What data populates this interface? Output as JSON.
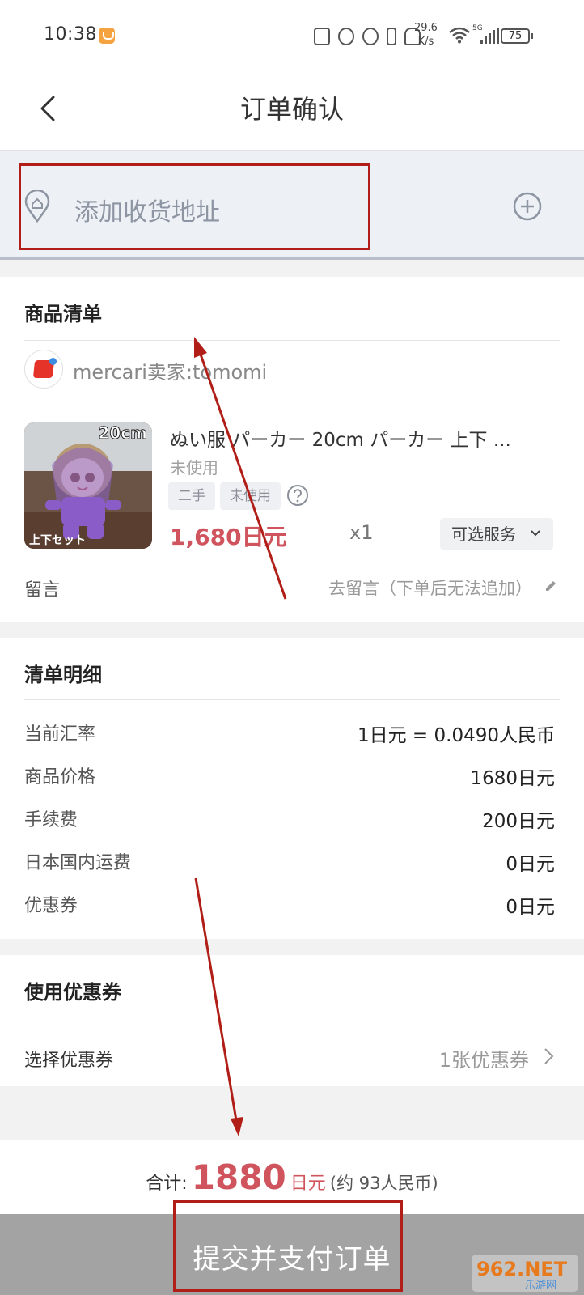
{
  "status_bar": {
    "time": "10:38",
    "net_speed_value": "29.6",
    "net_speed_unit": "K/s",
    "network_type": "5G",
    "battery": "75"
  },
  "navbar": {
    "title": "订单确认"
  },
  "address": {
    "placeholder": "添加收货地址"
  },
  "items_section": {
    "title": "商品清单",
    "seller": "mercari卖家:tomomi",
    "product": {
      "name": "ぬい服 パーカー 20cm パーカー 上下 ...",
      "condition": "未使用",
      "tags": [
        "二手",
        "未使用"
      ],
      "price": "1,680日元",
      "quantity": "x1",
      "service_button": "可选服务",
      "thumbnail_badge": "20cm",
      "thumbnail_caption": "上下セット"
    },
    "message": {
      "label": "留言",
      "value": "去留言（下单后无法追加）"
    }
  },
  "details_section": {
    "title": "清单明细",
    "rows": [
      {
        "label": "当前汇率",
        "value": "1日元 = 0.0490人民币"
      },
      {
        "label": "商品价格",
        "value": "1680日元"
      },
      {
        "label": "手续费",
        "value": "200日元"
      },
      {
        "label": "日本国内运费",
        "value": "0日元"
      },
      {
        "label": "优惠券",
        "value": "0日元"
      }
    ]
  },
  "coupon_section": {
    "title": "使用优惠券",
    "row_label": "选择优惠券",
    "row_value": "1张优惠券"
  },
  "total": {
    "label": "合计:",
    "amount": "1880",
    "unit": "日元",
    "cny": "(约 93人民币)"
  },
  "submit": {
    "label": "提交并支付订单"
  },
  "watermark": {
    "brand": "962.NET",
    "sub": "乐游网"
  },
  "colors": {
    "price_red": "#d0545e",
    "annotation_red": "#b01e17",
    "submit_gray": "#a3a3a3"
  }
}
